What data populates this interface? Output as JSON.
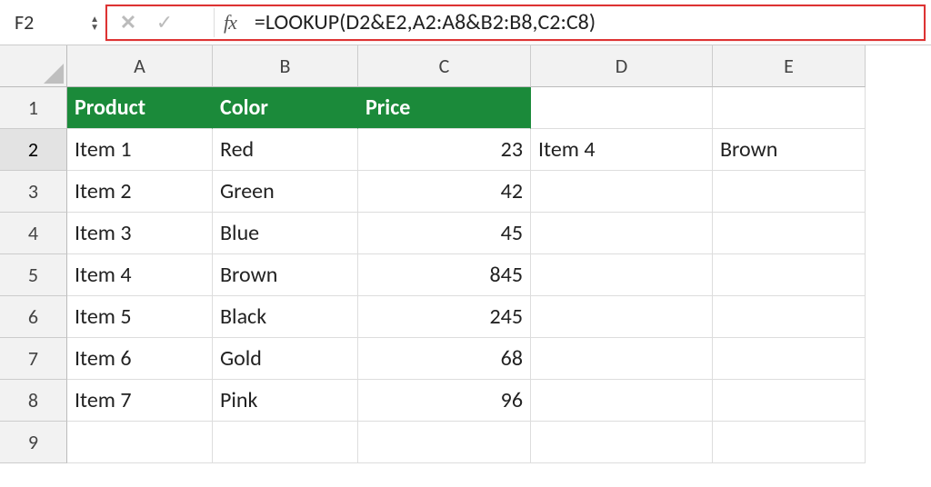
{
  "formula_bar": {
    "cell_ref": "F2",
    "fx_label": "fx",
    "formula": "=LOOKUP(D2&E2,A2:A8&B2:B8,C2:C8)"
  },
  "columns": [
    "A",
    "B",
    "C",
    "D",
    "E"
  ],
  "row_numbers": [
    "1",
    "2",
    "3",
    "4",
    "5",
    "6",
    "7",
    "8",
    "9"
  ],
  "headers": {
    "product": "Product",
    "color": "Color",
    "price": "Price"
  },
  "rows": [
    {
      "product": "Item 1",
      "color": "Red",
      "price": "23",
      "lookup_item": "Item 4",
      "lookup_color": "Brown"
    },
    {
      "product": "Item 2",
      "color": "Green",
      "price": "42",
      "lookup_item": "",
      "lookup_color": ""
    },
    {
      "product": "Item 3",
      "color": "Blue",
      "price": "45",
      "lookup_item": "",
      "lookup_color": ""
    },
    {
      "product": "Item 4",
      "color": "Brown",
      "price": "845",
      "lookup_item": "",
      "lookup_color": ""
    },
    {
      "product": "Item 5",
      "color": "Black",
      "price": "245",
      "lookup_item": "",
      "lookup_color": ""
    },
    {
      "product": "Item 6",
      "color": "Gold",
      "price": "68",
      "lookup_item": "",
      "lookup_color": ""
    },
    {
      "product": "Item 7",
      "color": "Pink",
      "price": "96",
      "lookup_item": "",
      "lookup_color": ""
    }
  ],
  "active_row": "2",
  "colors": {
    "header_bg": "#1b8a3a",
    "highlight_border": "#d33"
  }
}
